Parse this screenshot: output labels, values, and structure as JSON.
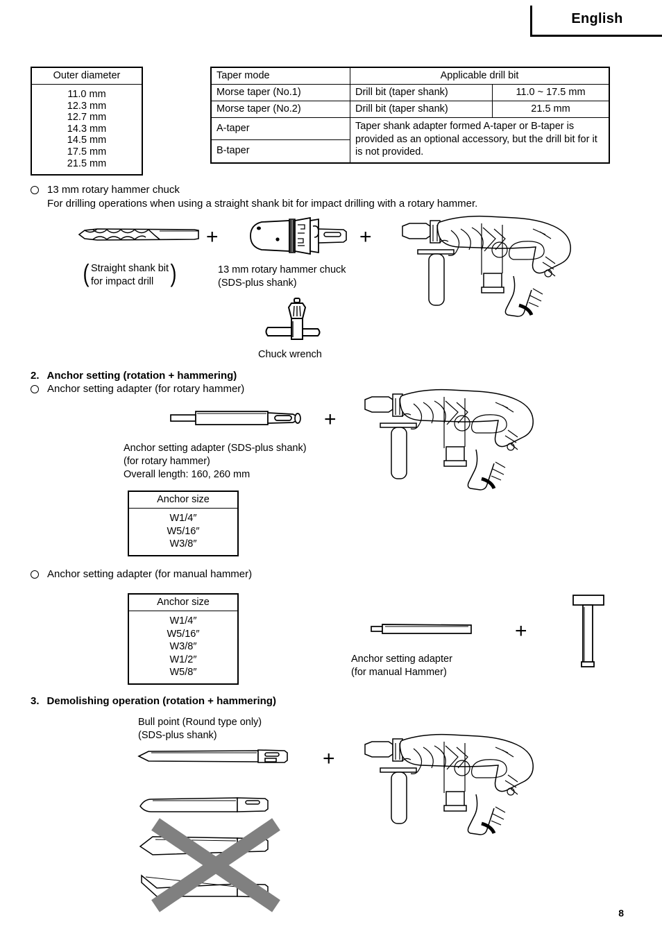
{
  "header": {
    "language": "English"
  },
  "outer_diameter_table": {
    "header": "Outer diameter",
    "values": [
      "11.0 mm",
      "12.3 mm",
      "12.7 mm",
      "14.3 mm",
      "14.5 mm",
      "17.5 mm",
      "21.5 mm"
    ]
  },
  "taper_table": {
    "col1_header": "Taper mode",
    "col2_header": "Applicable drill bit",
    "rows": [
      {
        "mode": "Morse taper (No.1)",
        "bit": "Drill bit (taper shank)",
        "size": "11.0 ~ 17.5 mm"
      },
      {
        "mode": "Morse taper (No.2)",
        "bit": "Drill bit (taper shank)",
        "size": "21.5 mm"
      }
    ],
    "a_taper": "A-taper",
    "b_taper": "B-taper",
    "note": "Taper shank adapter formed A-taper or B-taper is provided as an optional accessory, but the drill bit for it is not provided."
  },
  "section_chuck": {
    "title": "13 mm rotary hammer chuck",
    "description": "For drilling operations when using a straight shank bit for impact drilling with a rotary hammer.",
    "caption_straight_bit": "Straight  shank  bit\nfor impact drill",
    "caption_chuck": "13 mm rotary hammer chuck\n(SDS-plus shank)",
    "caption_wrench": "Chuck wrench",
    "plus_1": "+",
    "plus_2": "+"
  },
  "section_2": {
    "number": "2.",
    "title": "Anchor setting (rotation + hammering)",
    "bullet_rotary": "Anchor setting adapter (for rotary hammer)",
    "caption_rotary_adapter": "Anchor setting adapter (SDS-plus shank)\n(for rotary hammer)\nOverall length: 160, 260 mm",
    "plus_rotary": "+",
    "anchor_table_rotary": {
      "header": "Anchor size",
      "values": [
        "W1/4″",
        "W5/16″",
        "W3/8″"
      ]
    },
    "bullet_manual": "Anchor setting adapter (for manual hammer)",
    "anchor_table_manual": {
      "header": "Anchor size",
      "values": [
        "W1/4″",
        "W5/16″",
        "W3/8″",
        "W1/2″",
        "W5/8″"
      ]
    },
    "caption_manual_adapter": "Anchor setting adapter\n(for manual Hammer)",
    "plus_manual": "+"
  },
  "section_3": {
    "number": "3.",
    "title": "Demolishing operation (rotation + hammering)",
    "caption_bull_point": "Bull point (Round type only)\n(SDS-plus shank)",
    "plus_demolish": "+"
  },
  "footer": {
    "page_number": "8"
  },
  "colors": {
    "ink": "#000000",
    "paper": "#ffffff",
    "cross_out": "#808080"
  }
}
